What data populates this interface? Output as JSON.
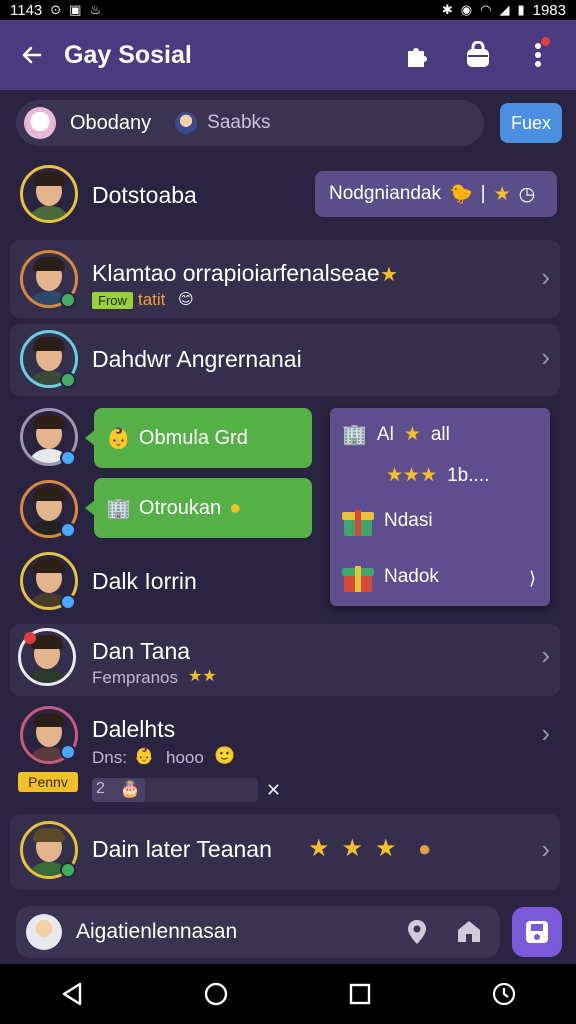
{
  "statusbar": {
    "time": "1143",
    "right_time": "1983"
  },
  "appbar": {
    "title": "Gay Sosial"
  },
  "search": {
    "value": "Obodany",
    "hint": "Saabks",
    "new_label": "Fuex"
  },
  "rows": [
    {
      "name": "Dotstoaba",
      "pill": "Nodgniandak"
    },
    {
      "name": "Klamtao orrapioiarfenalseae",
      "sub": "tatit",
      "tag": "Frow"
    },
    {
      "name": "Dahdwr Angrernanai"
    },
    {
      "bubble": "Obmula Grd"
    },
    {
      "bubble": "Otroukan"
    },
    {
      "name": "Dalk Iorrin"
    },
    {
      "name": "Dan Tana",
      "sub": "Fempranos"
    },
    {
      "name": "Dalelhts",
      "sub": "Dns:",
      "sub2": "hooo",
      "badge": "Pennv",
      "progress_label": "2",
      "progress": 0.32
    },
    {
      "name": "Dain later Teanan"
    }
  ],
  "popup": {
    "items": [
      {
        "label": "Al",
        "after": "all"
      },
      {
        "label": "1b...."
      },
      {
        "label": "Ndasi"
      },
      {
        "label": "Nadok"
      }
    ]
  },
  "composer": {
    "value": "Aigatienlennasan"
  },
  "colors": {
    "appbar": "#4a3a80",
    "bubble": "#55b048",
    "popup": "#5e4e8e",
    "accent": "#4a8fe0"
  }
}
